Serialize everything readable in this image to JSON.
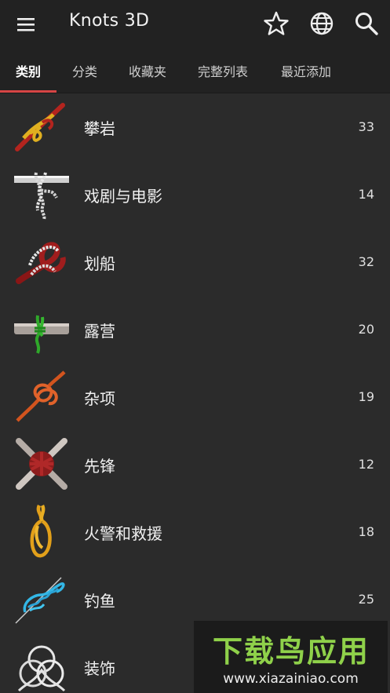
{
  "app": {
    "title": "Knots 3D",
    "icons": [
      "menu-icon",
      "star-icon",
      "globe-icon",
      "search-icon"
    ]
  },
  "tabs": [
    {
      "label": "类别",
      "active": true
    },
    {
      "label": "分类",
      "active": false
    },
    {
      "label": "收藏夹",
      "active": false
    },
    {
      "label": "完整列表",
      "active": false
    },
    {
      "label": "最近添加",
      "active": false
    }
  ],
  "colors": {
    "accent": "#d64545",
    "background": "#2b2b2b",
    "appbar": "#222222"
  },
  "categories": [
    {
      "label": "攀岩",
      "count": "33",
      "icon": "climbing-knot-icon"
    },
    {
      "label": "戏剧与电影",
      "count": "14",
      "icon": "theater-knot-icon"
    },
    {
      "label": "划船",
      "count": "32",
      "icon": "boating-knot-icon"
    },
    {
      "label": "露营",
      "count": "20",
      "icon": "camping-knot-icon"
    },
    {
      "label": "杂项",
      "count": "19",
      "icon": "misc-knot-icon"
    },
    {
      "label": "先锋",
      "count": "12",
      "icon": "pioneer-knot-icon"
    },
    {
      "label": "火警和救援",
      "count": "18",
      "icon": "rescue-knot-icon"
    },
    {
      "label": "钓鱼",
      "count": "25",
      "icon": "fishing-knot-icon"
    },
    {
      "label": "装饰",
      "count": "",
      "icon": "decorative-knot-icon"
    }
  ],
  "watermark": {
    "title": "下载鸟应用",
    "url": "www.xiazainiao.com"
  }
}
